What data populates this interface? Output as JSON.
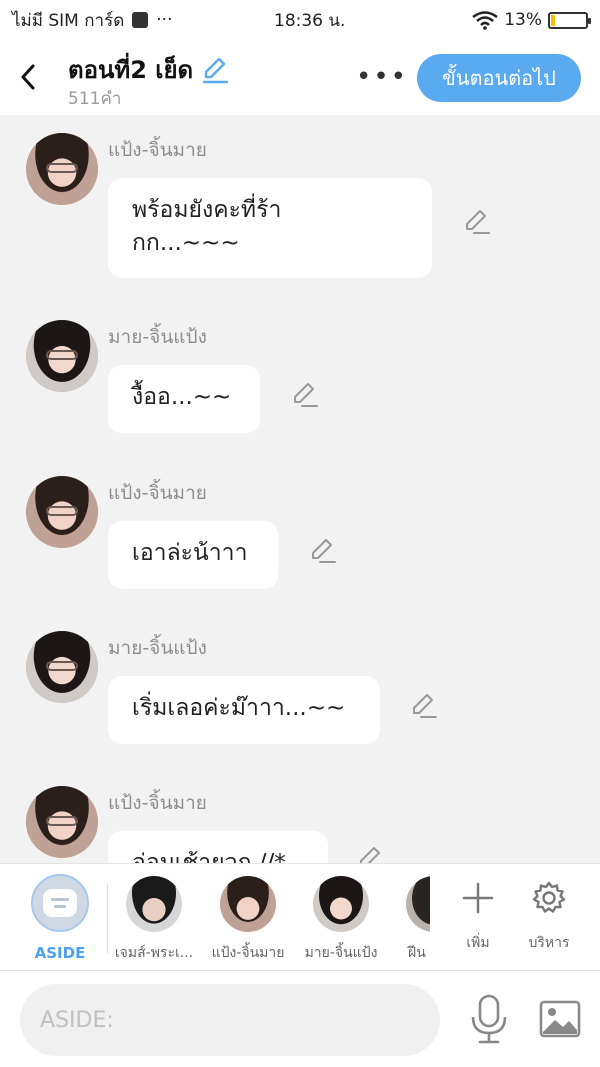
{
  "status_bar": {
    "carrier": "ไม่มี SIM การ์ด",
    "dots": "···",
    "time": "18:36 น.",
    "battery": "13%",
    "battery_level": 0.13
  },
  "header": {
    "back_icon": "chevron-left-icon",
    "title": "ตอนที่2 เย็ด",
    "word_count": "511คำ",
    "more": "•••",
    "next_label": "ขั้นตอนต่อไป"
  },
  "messages": [
    {
      "sender": "แป้ง-จิ้นมาย",
      "text": "พร้อมยังคะที่ร้า\nกก...~~~"
    },
    {
      "sender": "มาย-จิ้นแป้ง",
      "text": "งื้ออ...~~"
    },
    {
      "sender": "แป้ง-จิ้นมาย",
      "text": "เอาล่ะน้าาา"
    },
    {
      "sender": "มาย-จิ้นแป้ง",
      "text": "เริ่มเลอค่ะม๊าาา...~~"
    },
    {
      "sender": "แป้ง-จิ้นมาย",
      "text": "อ่อมเช้ายวก //*"
    }
  ],
  "characters": {
    "aside_label": "ASIDE",
    "items": [
      {
        "name": "เจมส์-พระเ..."
      },
      {
        "name": "แป้ง-จิ้นมาย"
      },
      {
        "name": "มาย-จิ้นแป้ง"
      },
      {
        "name": "ฝีน"
      }
    ],
    "add_label": "เพิ่ม",
    "manage_label": "บริหาร"
  },
  "input": {
    "placeholder": "ASIDE:"
  },
  "colors": {
    "accent": "#5aaaf0",
    "aside_label": "#4a9ff0",
    "background": "#f2f2f2"
  }
}
